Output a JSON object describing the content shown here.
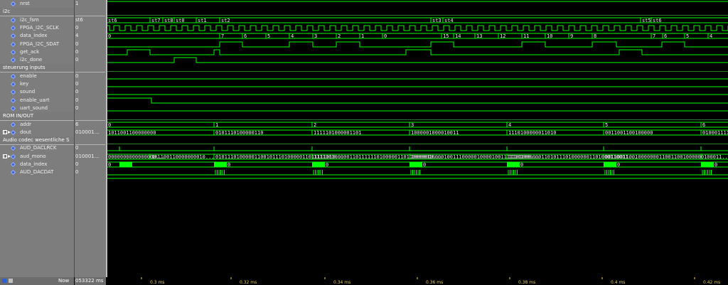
{
  "signals": [
    {
      "name": "nrst",
      "value": "1",
      "kind": "sig"
    },
    {
      "name": "i2c",
      "value": "",
      "kind": "group"
    },
    {
      "name": "i2c_fsm",
      "value": "st6",
      "kind": "sig"
    },
    {
      "name": "FPGA_I2C_SCLK",
      "value": "0",
      "kind": "sig"
    },
    {
      "name": "data_index",
      "value": "4",
      "kind": "sig"
    },
    {
      "name": "FPGA_I2C_SDAT",
      "value": "0",
      "kind": "sig"
    },
    {
      "name": "get_ack",
      "value": "0",
      "kind": "sig"
    },
    {
      "name": "i2c_done",
      "value": "0",
      "kind": "sig"
    },
    {
      "name": "steuerung inputs",
      "value": "",
      "kind": "group"
    },
    {
      "name": "enable",
      "value": "0",
      "kind": "sig"
    },
    {
      "name": "key",
      "value": "0",
      "kind": "sig"
    },
    {
      "name": "sound",
      "value": "0",
      "kind": "sig"
    },
    {
      "name": "enable_uart",
      "value": "0",
      "kind": "sig"
    },
    {
      "name": "uart_sound",
      "value": "0",
      "kind": "sig"
    },
    {
      "name": "ROM IN/OUT",
      "value": "",
      "kind": "group"
    },
    {
      "name": "addr",
      "value": "6",
      "kind": "sig"
    },
    {
      "name": "dout",
      "value": "010001...",
      "kind": "bus"
    },
    {
      "name": "Audio codec wesentliche S",
      "value": "",
      "kind": "group"
    },
    {
      "name": "AUD_DACLRCK",
      "value": "0",
      "kind": "sig"
    },
    {
      "name": "aud_mono",
      "value": "010001...",
      "kind": "bus"
    },
    {
      "name": "data_index",
      "value": "0",
      "kind": "sig"
    },
    {
      "name": "AUD_DACDAT",
      "value": "0",
      "kind": "sig"
    }
  ],
  "wave_labels": {
    "i2c_fsm": [
      "st6",
      "st7",
      "st8",
      "st0",
      "st1",
      "st2",
      "st3",
      "st4",
      "st5",
      "st6"
    ],
    "data_index": [
      "0",
      "7",
      "6",
      "5",
      "4",
      "3",
      "2",
      "1",
      "0",
      "15",
      "14",
      "13",
      "12",
      "11",
      "10",
      "9",
      "8",
      "7",
      "6",
      "5",
      "4"
    ],
    "addr": [
      "0",
      "1",
      "2",
      "3",
      "4",
      "5",
      "6"
    ],
    "dout": [
      "1011001100000000",
      "0101110100000110",
      "1111101000001101",
      "1000001000010011",
      "1110100000011010",
      "0011001100100000",
      "010001111"
    ],
    "aud_mono": [
      "0000000000000000...",
      "101100110000000010...",
      "0101110100000110010111010000011011111010...",
      "1111101000001101111110100000110110000010...",
      "1000001000010011100000100001001111101000...",
      "1110100000011010111010000001101000110011...",
      "001100110010000000110011001000000100011..."
    ],
    "data_index2": [
      "0",
      "0",
      "0",
      "0",
      "0",
      "0"
    ]
  },
  "footer": {
    "now_label": "Now",
    "now_value": "053322 ms",
    "time_ticks": [
      "0.3 ms",
      "0.32 ms",
      "0.34 ms",
      "0.36 ms",
      "0.38 ms",
      "0.4 ms",
      "0.42 ms"
    ]
  },
  "colors": {
    "wave": "#00ff00",
    "text": "#e8e8e8",
    "panel": "#7d7d7d",
    "cursor": "#f2d23a"
  }
}
